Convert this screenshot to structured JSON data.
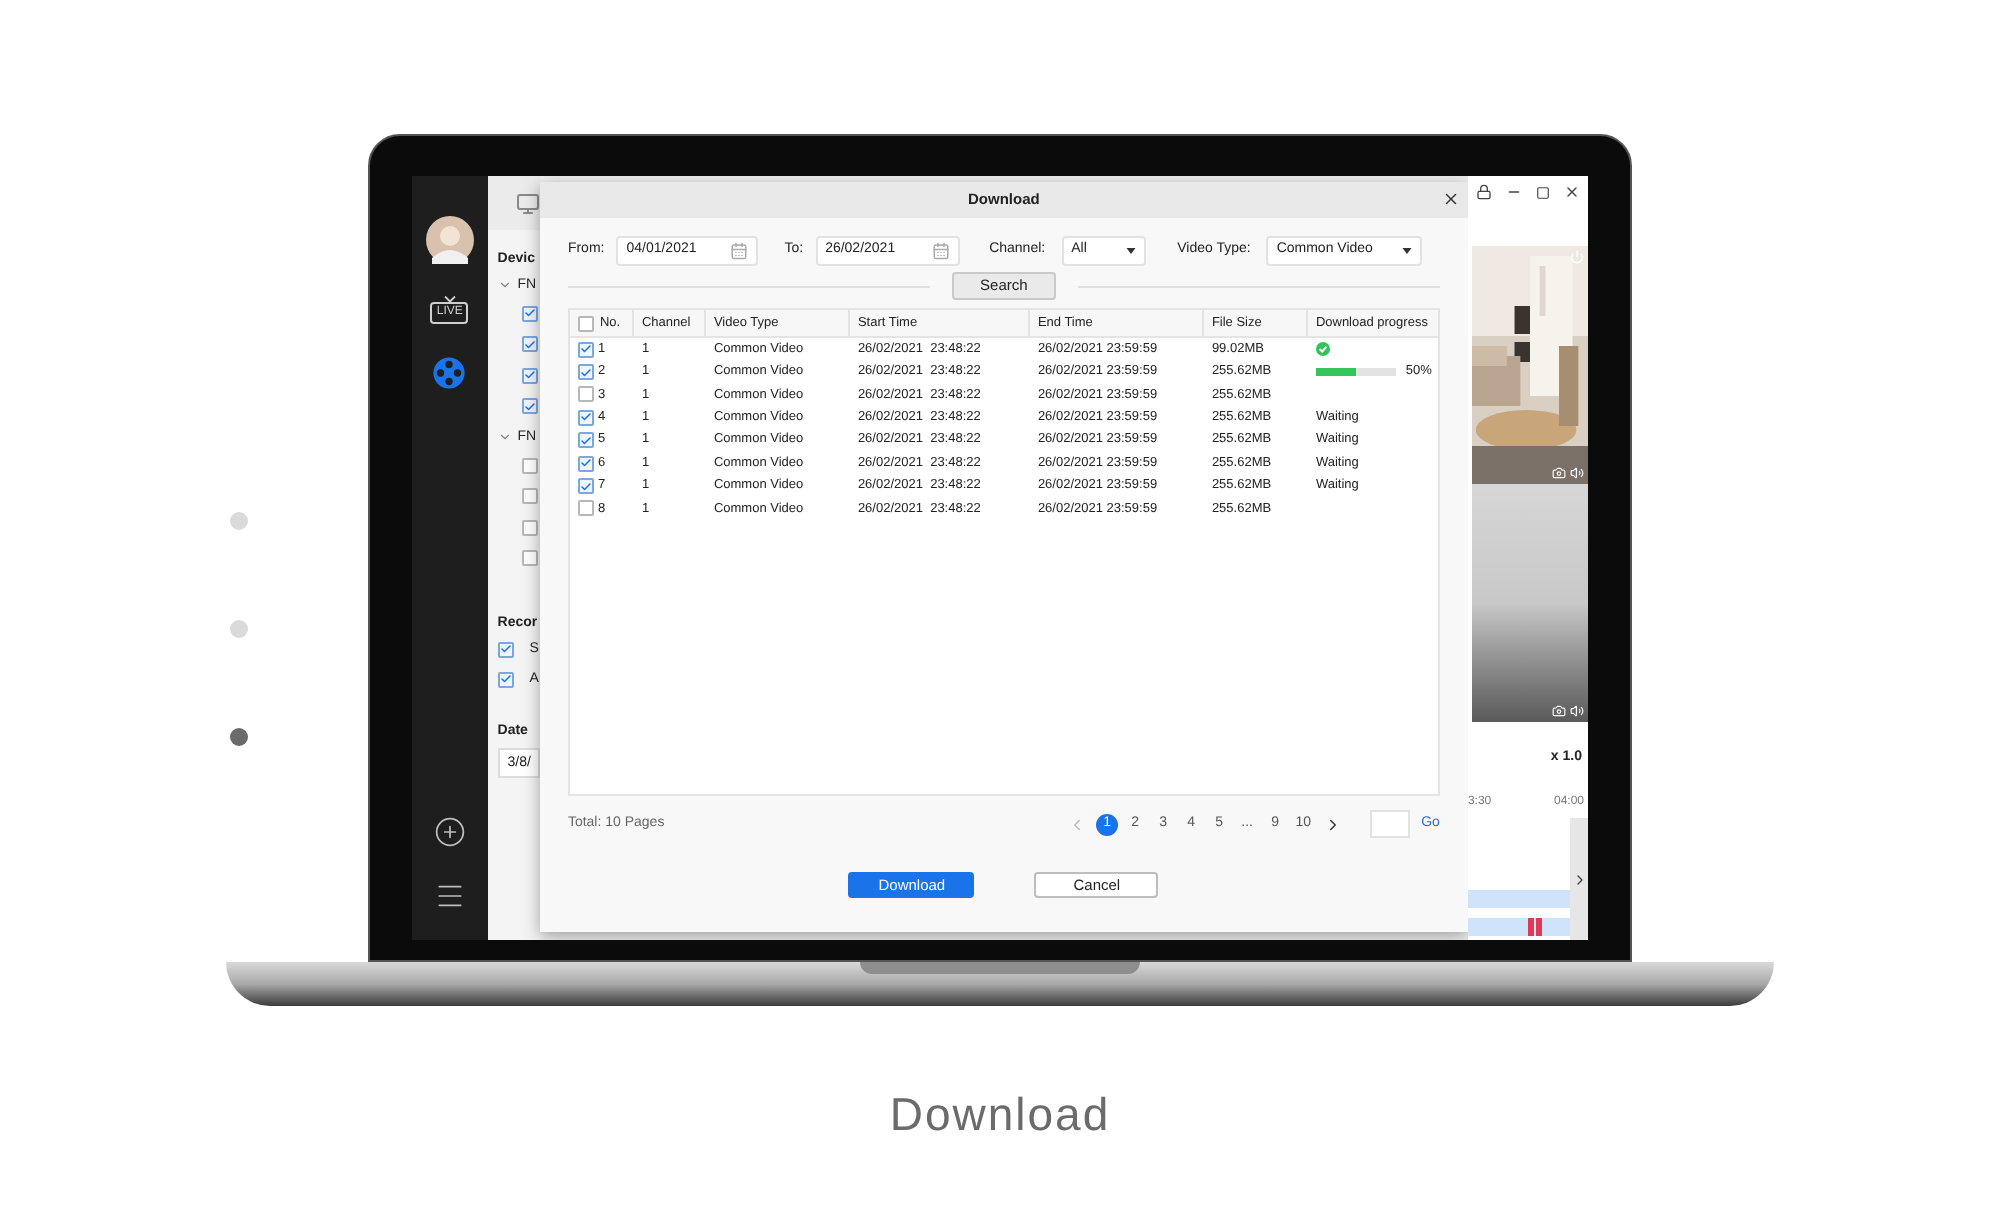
{
  "carousel": {
    "dots": [
      {
        "selected": false
      },
      {
        "selected": false
      },
      {
        "selected": true
      }
    ]
  },
  "caption": "Download",
  "sidebar": {
    "nav": [
      {
        "kind": "avatar",
        "selected": false
      },
      {
        "kind": "live",
        "label": "LIVE",
        "selected": false
      },
      {
        "kind": "playback",
        "selected": true
      }
    ],
    "bottom": [
      {
        "kind": "add"
      },
      {
        "kind": "menu"
      }
    ]
  },
  "left_panel": {
    "device_title": "Devic",
    "groups": [
      {
        "label": "FN",
        "expanded": true,
        "items": [
          {
            "checked": true
          },
          {
            "checked": true
          },
          {
            "checked": true
          },
          {
            "checked": true
          }
        ]
      },
      {
        "label": "FN",
        "expanded": true,
        "items": [
          {
            "checked": false
          },
          {
            "checked": false
          },
          {
            "checked": false
          },
          {
            "checked": false
          }
        ]
      }
    ],
    "record_title": "Recor",
    "record_items": [
      {
        "label": "S",
        "checked": true
      },
      {
        "label": "A",
        "checked": true
      }
    ],
    "date_title": "Date",
    "date_value": "3/8/"
  },
  "right_panel": {
    "speed": "x 1.0",
    "timeline_labels": [
      "3:30",
      "04:00"
    ]
  },
  "dialog": {
    "title": "Download",
    "filters": {
      "from_label": "From:",
      "from_value": "04/01/2021",
      "to_label": "To:",
      "to_value": "26/02/2021",
      "channel_label": "Channel:",
      "channel_value": "All",
      "type_label": "Video Type:",
      "type_value": "Common Video"
    },
    "search_button": "Search",
    "table": {
      "header_checked": false,
      "columns": [
        "No.",
        "Channel",
        "Video Type",
        "Start Time",
        "End Time",
        "File Size",
        "Download progress"
      ],
      "rows": [
        {
          "checked": true,
          "no": "1",
          "channel": "1",
          "type": "Common Video",
          "start": "26/02/2021  23:48:22",
          "end": "26/02/2021 23:59:59",
          "size": "99.02MB",
          "progress": {
            "kind": "done"
          }
        },
        {
          "checked": true,
          "no": "2",
          "channel": "1",
          "type": "Common Video",
          "start": "26/02/2021  23:48:22",
          "end": "26/02/2021 23:59:59",
          "size": "255.62MB",
          "progress": {
            "kind": "bar",
            "level": 0.5,
            "reading": "50%"
          }
        },
        {
          "checked": false,
          "no": "3",
          "channel": "1",
          "type": "Common Video",
          "start": "26/02/2021  23:48:22",
          "end": "26/02/2021 23:59:59",
          "size": "255.62MB"
        },
        {
          "checked": true,
          "no": "4",
          "channel": "1",
          "type": "Common Video",
          "start": "26/02/2021  23:48:22",
          "end": "26/02/2021 23:59:59",
          "size": "255.62MB",
          "progress": {
            "kind": "text",
            "text": "Waiting"
          }
        },
        {
          "checked": true,
          "no": "5",
          "channel": "1",
          "type": "Common Video",
          "start": "26/02/2021  23:48:22",
          "end": "26/02/2021 23:59:59",
          "size": "255.62MB",
          "progress": {
            "kind": "text",
            "text": "Waiting"
          }
        },
        {
          "checked": true,
          "no": "6",
          "channel": "1",
          "type": "Common Video",
          "start": "26/02/2021  23:48:22",
          "end": "26/02/2021 23:59:59",
          "size": "255.62MB",
          "progress": {
            "kind": "text",
            "text": "Waiting"
          }
        },
        {
          "checked": true,
          "no": "7",
          "channel": "1",
          "type": "Common Video",
          "start": "26/02/2021  23:48:22",
          "end": "26/02/2021 23:59:59",
          "size": "255.62MB",
          "progress": {
            "kind": "text",
            "text": "Waiting"
          }
        },
        {
          "checked": false,
          "no": "8",
          "channel": "1",
          "type": "Common Video",
          "start": "26/02/2021  23:48:22",
          "end": "26/02/2021 23:59:59",
          "size": "255.62MB"
        }
      ]
    },
    "total": "Total: 10 Pages",
    "pages": [
      {
        "label": "1",
        "selected": true
      },
      {
        "label": "2",
        "selected": false
      },
      {
        "label": "3",
        "selected": false
      },
      {
        "label": "4",
        "selected": false
      },
      {
        "label": "5",
        "selected": false
      },
      {
        "label": "...",
        "selected": false
      },
      {
        "label": "9",
        "selected": false
      },
      {
        "label": "10",
        "selected": false
      }
    ],
    "go": "Go",
    "buttons": [
      {
        "label": "Download",
        "kind": "primary"
      },
      {
        "label": "Cancel",
        "kind": "secondary"
      }
    ]
  }
}
